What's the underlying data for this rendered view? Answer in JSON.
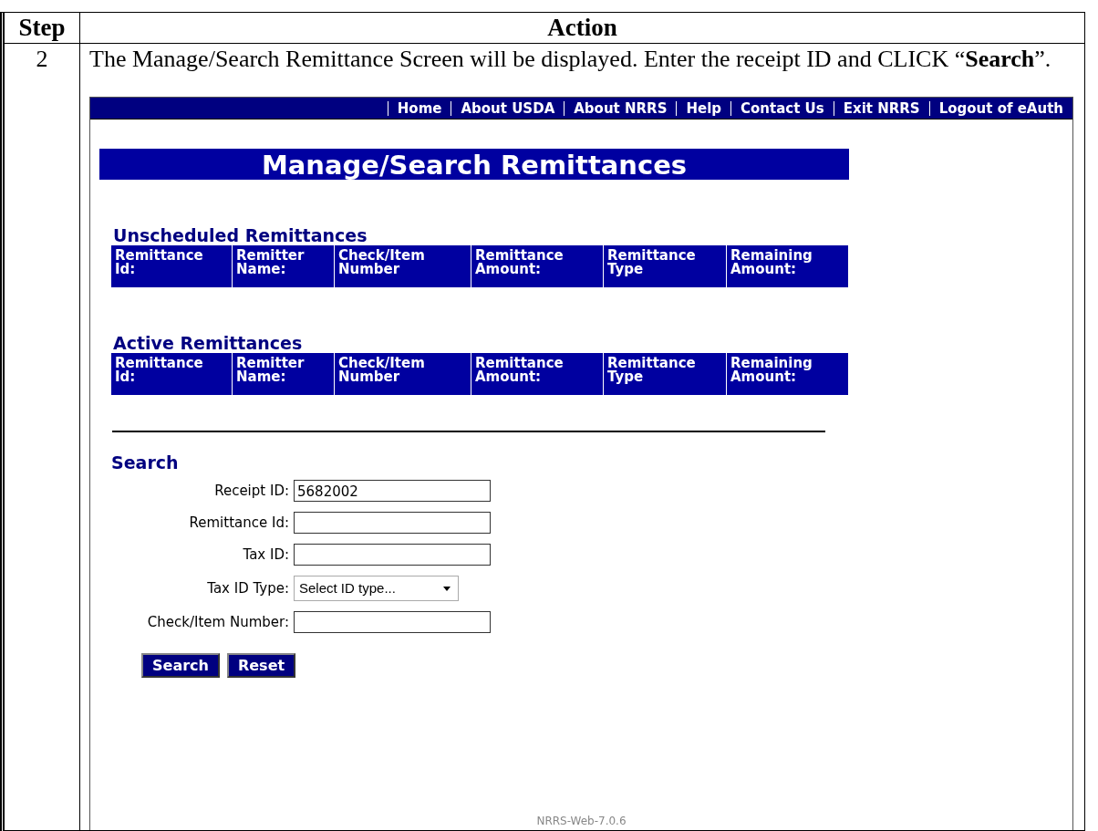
{
  "document": {
    "columns": [
      "Step",
      "Action"
    ],
    "step": "2",
    "instruction": "The Manage/Search Remittance Screen will be displayed.  Enter the receipt ID and CLICK “**Search**”."
  },
  "screen": {
    "nav": [
      "Home",
      "About USDA",
      "About NRRS",
      "Help",
      "Contact Us",
      "Exit NRRS",
      "Logout of eAuth"
    ],
    "title": "Manage/Search Remittances",
    "sections": [
      {
        "heading": "Unscheduled Remittances",
        "columns": [
          "Remittance Id:",
          "Remitter Name:",
          "Check/Item Number",
          "Remittance Amount:",
          "Remittance Type",
          "Remaining Amount:"
        ]
      },
      {
        "heading": "Active Remittances",
        "columns": [
          "Remittance Id:",
          "Remitter Name:",
          "Check/Item Number",
          "Remittance Amount:",
          "Remittance Type",
          "Remaining Amount:"
        ]
      }
    ],
    "search": {
      "heading": "Search",
      "fields": [
        {
          "kind": "text",
          "label": "Receipt ID:",
          "value": "5682002"
        },
        {
          "kind": "text",
          "label": "Remittance Id:"
        },
        {
          "kind": "text",
          "label": "Tax ID:"
        },
        {
          "kind": "select",
          "label": "Tax ID Type:",
          "value": "Select ID type..."
        },
        {
          "kind": "text",
          "label": "Check/Item Number:"
        }
      ],
      "buttons": [
        "Search",
        "Reset"
      ]
    },
    "footer": "NRRS-Web-7.0.6"
  }
}
